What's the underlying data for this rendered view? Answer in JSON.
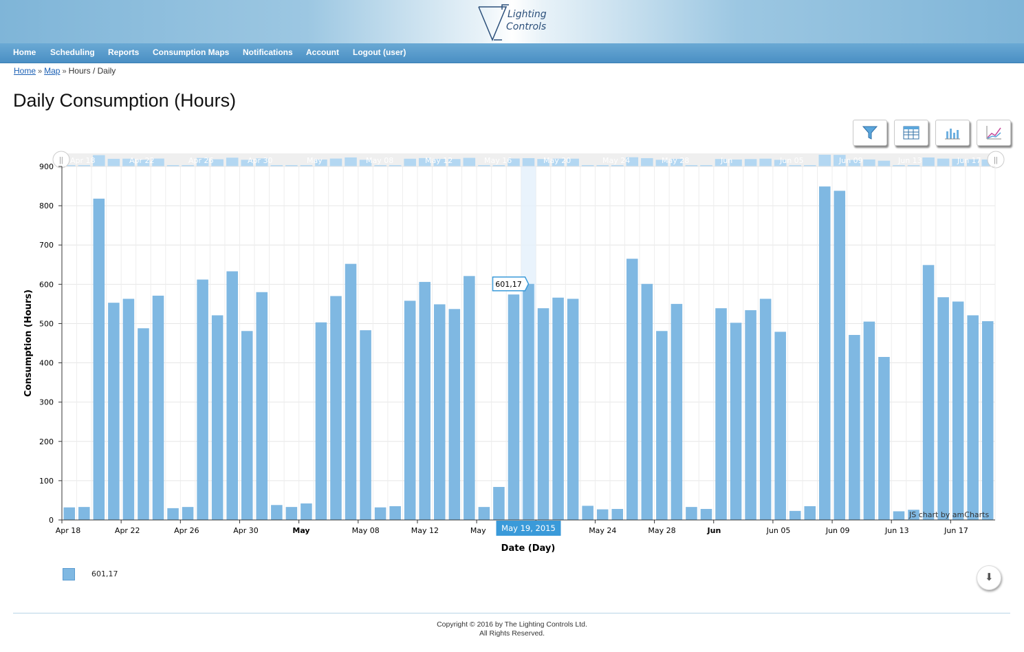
{
  "logo": {
    "line1": "Lighting",
    "line2": "Controls"
  },
  "nav": {
    "home": "Home",
    "scheduling": "Scheduling",
    "reports": "Reports",
    "consumption_maps": "Consumption Maps",
    "notifications": "Notifications",
    "account": "Account",
    "logout": "Logout (user)"
  },
  "breadcrumb": {
    "home": "Home",
    "map": "Map",
    "current": "Hours / Daily"
  },
  "page_title": "Daily Consumption (Hours)",
  "toolbar": {
    "filter_icon": "funnel-icon",
    "table_icon": "table-icon",
    "bar_icon": "bar-chart-icon",
    "line_icon": "line-chart-icon"
  },
  "chart_data": {
    "type": "bar",
    "ylabel": "Consumption (Hours)",
    "xlabel": "Date (Day)",
    "ylim": [
      0,
      900
    ],
    "yticks": [
      0,
      100,
      200,
      300,
      400,
      500,
      600,
      700,
      800,
      900
    ],
    "grid": true,
    "color": "#7fb8e2",
    "x_tick_labels": [
      {
        "label": "Apr 18",
        "index": 0,
        "bold": false
      },
      {
        "label": "Apr 22",
        "index": 4,
        "bold": false
      },
      {
        "label": "Apr 26",
        "index": 8,
        "bold": false
      },
      {
        "label": "Apr 30",
        "index": 12,
        "bold": false
      },
      {
        "label": "May",
        "index": 16,
        "bold": true
      },
      {
        "label": "May 08",
        "index": 20,
        "bold": false
      },
      {
        "label": "May 12",
        "index": 24,
        "bold": false
      },
      {
        "label": "May",
        "index": 28,
        "bold": false
      },
      {
        "label": "May 20",
        "index": 32,
        "bold": false
      },
      {
        "label": "May 24",
        "index": 36,
        "bold": false
      },
      {
        "label": "May 28",
        "index": 40,
        "bold": false
      },
      {
        "label": "Jun",
        "index": 44,
        "bold": true
      },
      {
        "label": "Jun 05",
        "index": 48,
        "bold": false
      },
      {
        "label": "Jun 09",
        "index": 52,
        "bold": false
      },
      {
        "label": "Jun 13",
        "index": 56,
        "bold": false
      },
      {
        "label": "Jun 17",
        "index": 60,
        "bold": false
      }
    ],
    "scrollbar_labels": [
      "Apr 18",
      "Apr 22",
      "Apr 26",
      "Apr 30",
      "May",
      "May 08",
      "May 12",
      "May 16",
      "May 20",
      "May 24",
      "May 28",
      "Jun",
      "Jun 05",
      "Jun 09",
      "Jun 13",
      "Jun 17"
    ],
    "values": [
      32,
      33,
      818,
      553,
      563,
      488,
      571,
      30,
      33,
      612,
      521,
      633,
      481,
      580,
      38,
      33,
      42,
      503,
      570,
      652,
      483,
      32,
      35,
      558,
      606,
      549,
      537,
      621,
      33,
      84,
      574,
      601,
      539,
      566,
      563,
      36,
      27,
      28,
      665,
      601,
      481,
      550,
      33,
      28,
      539,
      502,
      534,
      563,
      479,
      23,
      35,
      849,
      838,
      471,
      505,
      415,
      22,
      26,
      649,
      567,
      556,
      521,
      506
    ],
    "cursor": {
      "index": 31,
      "date_label": "May 19, 2015",
      "value_label": "601,17"
    }
  },
  "legend": {
    "label": "601,17"
  },
  "credit": "JS chart by amCharts",
  "download_icon": "download-icon",
  "footer": {
    "line1": "Copyright © 2016 by The Lighting Controls Ltd.",
    "line2": "All Rights Reserved."
  }
}
